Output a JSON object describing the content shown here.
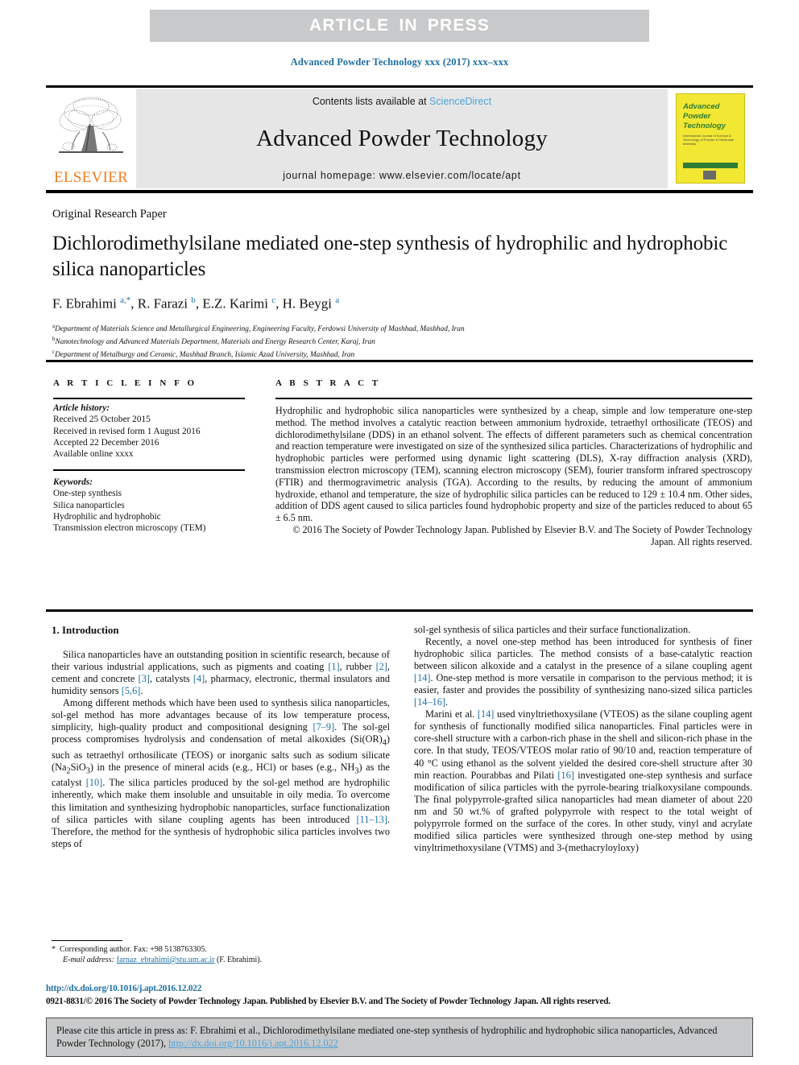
{
  "banner": {
    "label": "ARTICLE  IN  PRESS"
  },
  "running_head": "Advanced Powder Technology xxx (2017) xxx–xxx",
  "masthead": {
    "publisher_name": "ELSEVIER",
    "publisher_logo_icon": "elsevier-tree-icon",
    "contents_prefix": "Contents lists available at ",
    "contents_link": "ScienceDirect",
    "journal_title": "Advanced Powder Technology",
    "homepage_line": "journal homepage: www.elsevier.com/locate/apt",
    "cover": {
      "line1": "Advanced",
      "line2": "Powder",
      "line3": "Technology",
      "subtitle": "International Journal of Science & Technology of Powder & Particulate Materials"
    }
  },
  "title_block": {
    "paper_type": "Original Research Paper",
    "title": "Dichlorodimethylsilane mediated one-step synthesis of hydrophilic and hydrophobic silica nanoparticles",
    "authors_html": "F. Ebrahimi <sup>a,*</sup>, R. Farazi <sup>b</sup>, E.Z. Karimi <sup>c</sup>, H. Beygi <sup>a</sup>",
    "affiliations": [
      {
        "marker": "a",
        "text": "Department of Materials Science and Metallurgical Engineering, Engineering Faculty, Ferdowsi University of Mashhad, Mashhad, Iran"
      },
      {
        "marker": "b",
        "text": "Nanotechnology and Advanced Materials Department, Materials and Energy Research Center, Karaj, Iran"
      },
      {
        "marker": "c",
        "text": "Department of Metalburgy and Ceramic, Mashhad Branch, Islamic Azad University, Mashhad, Iran"
      }
    ]
  },
  "article_info": {
    "heading": "A R T I C L E  I N F O",
    "history_label": "Article history:",
    "history": [
      "Received 25 October 2015",
      "Received in revised form 1 August 2016",
      "Accepted 22 December 2016",
      "Available online xxxx"
    ],
    "keywords_label": "Keywords:",
    "keywords": [
      "One-step synthesis",
      "Silica nanoparticles",
      "Hydrophilic and hydrophobic",
      "Transmission electron microscopy (TEM)"
    ]
  },
  "abstract": {
    "heading": "A B S T R A C T",
    "body": "Hydrophilic and hydrophobic silica nanoparticles were synthesized by a cheap, simple and low temperature one-step method. The method involves a catalytic reaction between ammonium hydroxide, tetraethyl orthosilicate (TEOS) and dichlorodimethylsilane (DDS) in an ethanol solvent. The effects of different parameters such as chemical concentration and reaction temperature were investigated on size of the synthesized silica particles. Characterizations of hydrophilic and hydrophobic particles were performed using dynamic light scattering (DLS), X-ray diffraction analysis (XRD), transmission electron microscopy (TEM), scanning electron microscopy (SEM), fourier transform infrared spectroscopy (FTIR) and thermogravimetric analysis (TGA). According to the results, by reducing the amount of ammonium hydroxide, ethanol and temperature, the size of hydrophilic silica particles can be reduced to 129 ± 10.4 nm. Other sides, addition of DDS agent caused to silica particles found hydrophobic property and size of the particles reduced to about 65 ± 6.5 nm.",
    "copyright": "© 2016 The Society of Powder Technology Japan. Published by Elsevier B.V. and The Society of Powder Technology Japan. All rights reserved."
  },
  "body": {
    "section_heading": "1. Introduction",
    "left_paragraphs": [
      "Silica nanoparticles have an outstanding position in scientific research, because of their various industrial applications, such as pigments and coating [1], rubber [2], cement and concrete [3], catalysts [4], pharmacy, electronic, thermal insulators and humidity sensors [5,6].",
      "Among different methods which have been used to synthesis silica nanoparticles, sol-gel method has more advantages because of its low temperature process, simplicity, high-quality product and compositional designing [7–9]. The sol-gel process compromises hydrolysis and condensation of metal alkoxides (Si(OR)4) such as tetraethyl orthosilicate (TEOS) or inorganic salts such as sodium silicate (Na2SiO3) in the presence of mineral acids (e.g., HCl) or bases (e.g., NH3) as the catalyst [10]. The silica particles produced by the sol-gel method are hydrophilic inherently, which make them insoluble and unsuitable in oily media. To overcome this limitation and synthesizing hydrophobic nanoparticles, surface functionalization of silica particles with silane coupling agents has been introduced [11–13]. Therefore, the method for the synthesis of hydrophobic silica particles involves two steps of"
    ],
    "right_paragraphs": [
      "sol-gel synthesis of silica particles and their surface functionalization.",
      "Recently, a novel one-step method has been introduced for synthesis of finer hydrophobic silica particles. The method consists of a base-catalytic reaction between silicon alkoxide and a catalyst in the presence of a silane coupling agent [14]. One-step method is more versatile in comparison to the pervious method; it is easier, faster and provides the possibility of synthesizing nano-sized silica particles [14–16].",
      "Marini et al. [14] used vinyltriethoxysilane (VTEOS) as the silane coupling agent for synthesis of functionally modified silica nanoparticles. Final particles were in core-shell structure with a carbon-rich phase in the shell and silicon-rich phase in the core. In that study, TEOS/VTEOS molar ratio of 90/10 and, reaction temperature of 40 °C using ethanol as the solvent yielded the desired core-shell structure after 30 min reaction. Pourabbas and Pilati [16] investigated one-step synthesis and surface modification of silica particles with the pyrrole-bearing trialkoxysilane compounds. The final polypyrrole-grafted silica nanoparticles had mean diameter of about 220 nm and 50 wt.% of grafted polypyrrole with respect to the total weight of polypyrrole formed on the surface of the cores. In other study, vinyl and acrylate modified silica particles were synthesized through one-step method by using vinyltrimethoxysilane (VTMS) and 3-(methacryloyloxy)"
    ]
  },
  "footnote": {
    "star": "*",
    "corresponding": "Corresponding author. Fax: +98 5138763305.",
    "email_label": "E-mail address:",
    "email": "farnaz_ebrahimi@stu.um.ac.ir",
    "email_suffix": "(F. Ebrahimi)."
  },
  "footer": {
    "doi": "http://dx.doi.org/10.1016/j.apt.2016.12.022",
    "issn_line": "0921-8831/© 2016 The Society of Powder Technology Japan. Published by Elsevier B.V. and The Society of Powder Technology Japan. All rights reserved."
  },
  "cite_box": {
    "text": "Please cite this article in press as: F. Ebrahimi et al., Dichlorodimethylsilane mediated one-step synthesis of hydrophilic and hydrophobic silica nanoparticles, Advanced Powder Technology (2017), ",
    "link": "http://dx.doi.org/10.1016/j.apt.2016.12.022"
  },
  "colors": {
    "link_blue": "#1d6fa5",
    "sciencedirect_blue": "#4fa3d8",
    "elsevier_orange": "#f07d20",
    "band_gray": "#c8c9ca",
    "banner_gray": "#e6e6e6",
    "cover_yellow": "#f2e733",
    "cover_green": "#2e7d32"
  }
}
